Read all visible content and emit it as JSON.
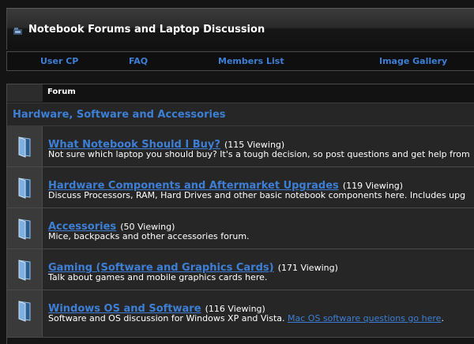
{
  "header": {
    "title": "Notebook Forums and Laptop Discussion",
    "icon": "site-icon"
  },
  "nav": {
    "items": [
      "User CP",
      "FAQ",
      "Members List",
      "Image Gallery"
    ]
  },
  "table": {
    "column_header": "Forum",
    "category": "Hardware, Software and Accessories",
    "forums": [
      {
        "name": "What Notebook Should I Buy?",
        "viewing": "(115 Viewing)",
        "description": "Not sure which laptop you should buy? It's a tough decision, so post questions and get help from",
        "icon": "forum-folder-icon"
      },
      {
        "name": "Hardware Components and Aftermarket Upgrades",
        "viewing": "(119 Viewing)",
        "description": "Discuss Processors, RAM, Hard Drives and other basic notebook components here. Includes upg",
        "icon": "forum-folder-icon"
      },
      {
        "name": "Accessories",
        "viewing": "(50 Viewing)",
        "description": "Mice, backpacks and other accessories forum.",
        "icon": "forum-folder-icon"
      },
      {
        "name": "Gaming (Software and Graphics Cards)",
        "viewing": "(171 Viewing)",
        "description": "Talk about games and mobile graphics cards here.",
        "icon": "forum-folder-icon"
      },
      {
        "name": "Windows OS and Software",
        "viewing": "(116 Viewing)",
        "description": "Software and OS discussion for Windows XP and Vista.",
        "description_link": "Mac OS software questions go here",
        "description_suffix": ".",
        "icon": "forum-folder-icon"
      }
    ]
  },
  "colors": {
    "link": "#3d7fd6",
    "background": "#141414",
    "row": "#262626",
    "icon_cell": "#3a3a3a"
  }
}
